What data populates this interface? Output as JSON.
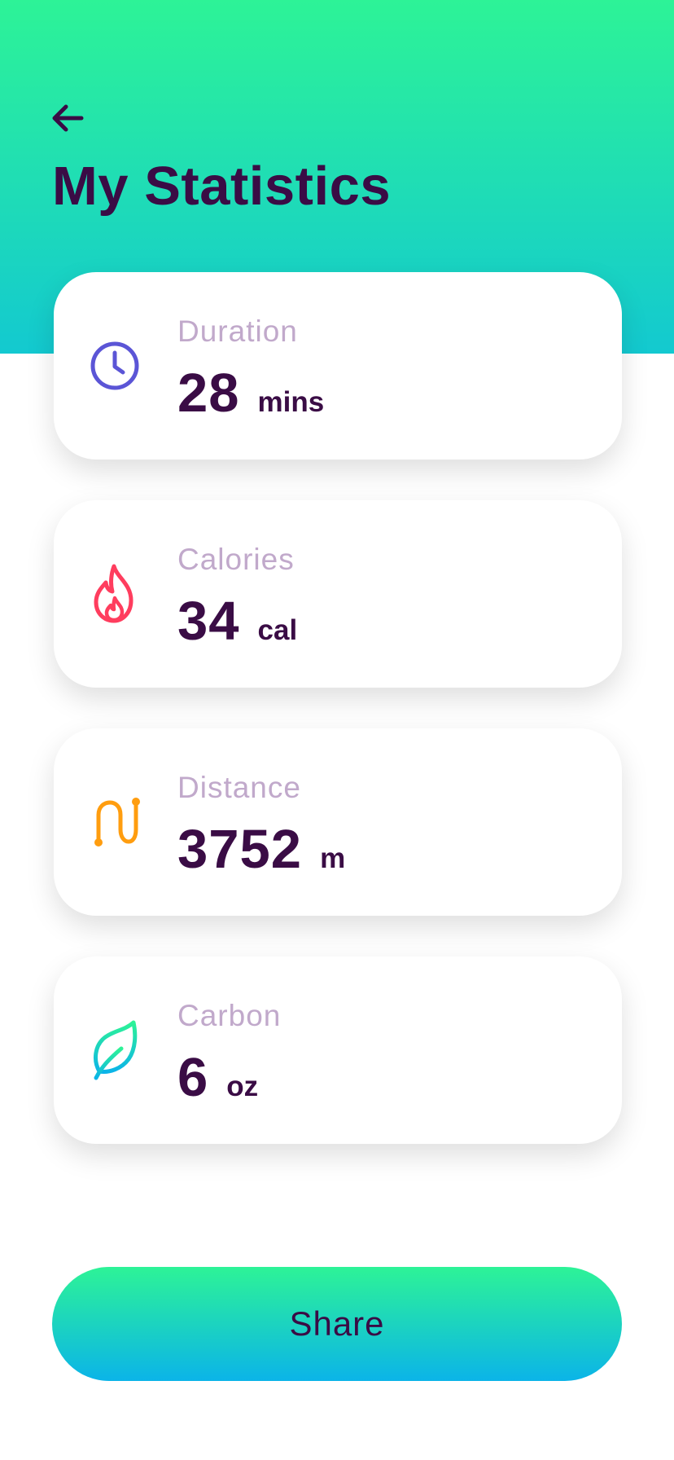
{
  "header": {
    "title": "My Statistics",
    "back_icon": "arrow-left-icon",
    "gradient_colors": [
      "#2df397",
      "#13c9d0"
    ]
  },
  "stats": [
    {
      "label": "Duration",
      "value": "28",
      "unit": "mins",
      "icon": "clock-icon",
      "icon_color": "#5b55d6"
    },
    {
      "label": "Calories",
      "value": "34",
      "unit": "cal",
      "icon": "flame-icon",
      "icon_color": "#ff3d5e"
    },
    {
      "label": "Distance",
      "value": "3752",
      "unit": "m",
      "icon": "route-icon",
      "icon_color": "#ff9d0f"
    },
    {
      "label": "Carbon",
      "value": "6",
      "unit": "oz",
      "icon": "leaf-icon",
      "icon_color": "#1fd3b4"
    }
  ],
  "share_button": {
    "label": "Share",
    "gradient_colors": [
      "#2df397",
      "#0bb4e8"
    ]
  },
  "colors": {
    "text_primary": "#3a0c45",
    "text_label": "#c1a9cb"
  }
}
